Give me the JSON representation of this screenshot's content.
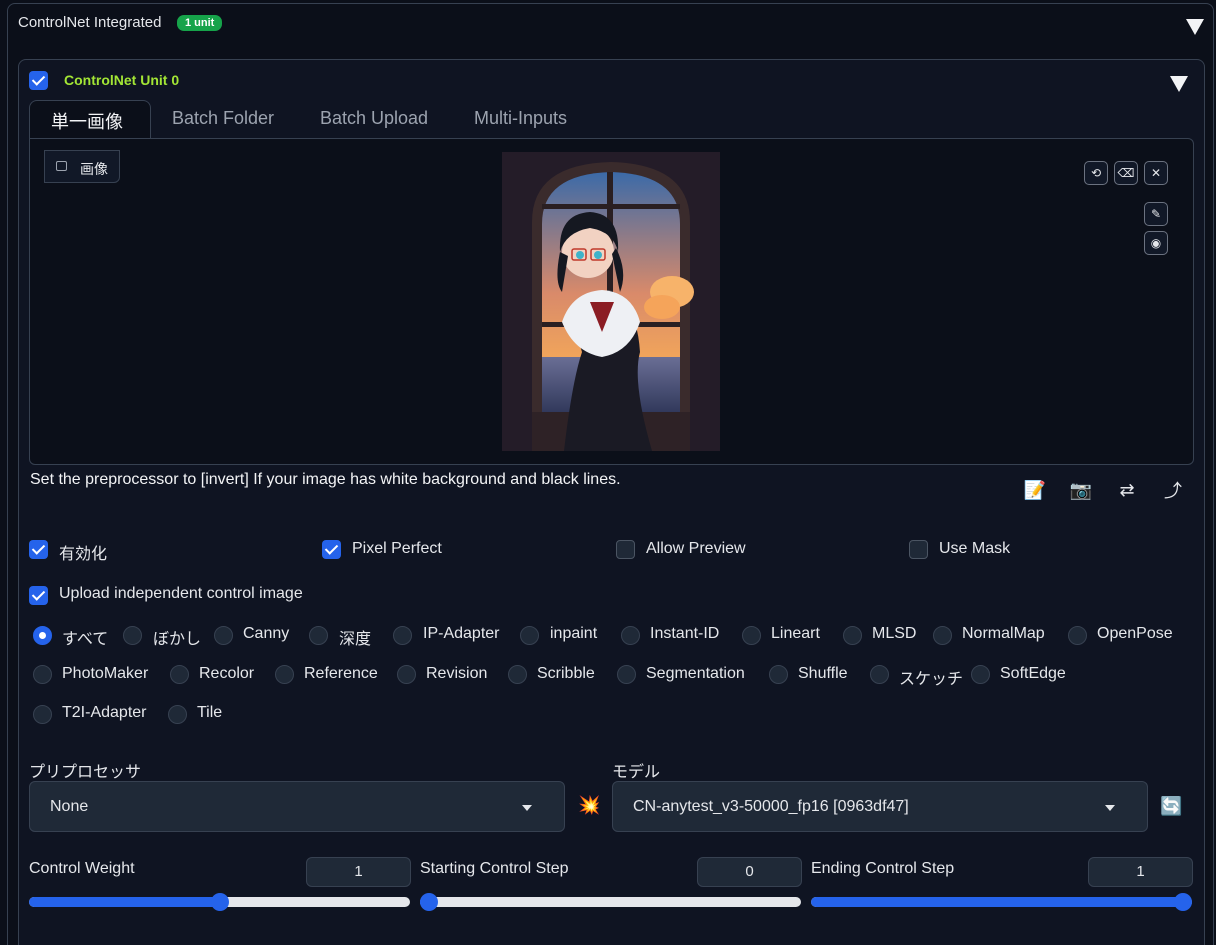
{
  "header": {
    "title": "ControlNet Integrated",
    "badge": "1 unit"
  },
  "unit": {
    "title": "ControlNet Unit 0",
    "enabled": true
  },
  "tabs": [
    {
      "label": "単一画像",
      "active": true
    },
    {
      "label": "Batch Folder",
      "active": false
    },
    {
      "label": "Batch Upload",
      "active": false
    },
    {
      "label": "Multi-Inputs",
      "active": false
    }
  ],
  "image_panel": {
    "label": "画像"
  },
  "image_tools": {
    "undo": "⟲",
    "eraser": "⌫",
    "close": "✕",
    "brush": "✎",
    "palette": "◉"
  },
  "hint_text": "Set the preprocessor to [invert] If your image has white background and black lines.",
  "actions": {
    "edit": "📝",
    "camera": "📷",
    "swap": "⇄",
    "send": "⤴"
  },
  "options": [
    {
      "label": "有効化",
      "checked": true
    },
    {
      "label": "Pixel Perfect",
      "checked": true
    },
    {
      "label": "Allow Preview",
      "checked": false
    },
    {
      "label": "Use Mask",
      "checked": false
    }
  ],
  "upload_independent": {
    "label": "Upload independent control image",
    "checked": true
  },
  "control_types": [
    [
      "すべて",
      "ぼかし",
      "Canny",
      "深度",
      "IP-Adapter",
      "inpaint",
      "Instant-ID",
      "Lineart",
      "MLSD",
      "NormalMap",
      "OpenPose"
    ],
    [
      "PhotoMaker",
      "Recolor",
      "Reference",
      "Revision",
      "Scribble",
      "Segmentation",
      "Shuffle",
      "スケッチ",
      "SoftEdge"
    ],
    [
      "T2I-Adapter",
      "Tile"
    ]
  ],
  "selected_control_type": "すべて",
  "preprocessor": {
    "label": "プリプロセッサ",
    "value": "None"
  },
  "run_icon": "💥",
  "model": {
    "label": "モデル",
    "value": "CN-anytest_v3-50000_fp16 [0963df47]"
  },
  "refresh_icon": "🔄",
  "sliders": [
    {
      "label": "Control Weight",
      "value": "1",
      "fraction": 0.5
    },
    {
      "label": "Starting Control Step",
      "value": "0",
      "fraction": 0.0
    },
    {
      "label": "Ending Control Step",
      "value": "1",
      "fraction": 1.0
    }
  ],
  "colors": {
    "accent": "#2563eb",
    "unit_title": "#a3e635",
    "badge": "#16a34a"
  }
}
